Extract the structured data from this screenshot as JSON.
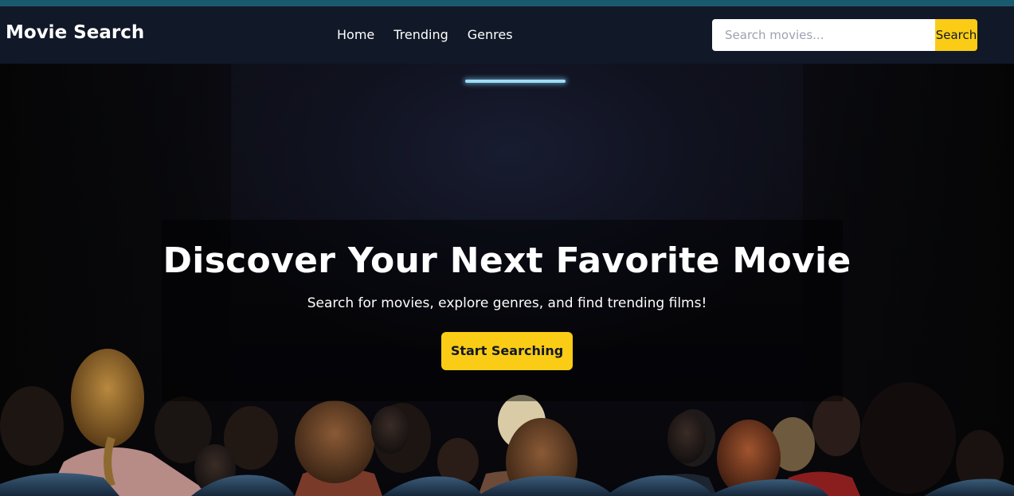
{
  "navbar": {
    "brand": "Movie Search",
    "links": [
      {
        "label": "Home"
      },
      {
        "label": "Trending"
      },
      {
        "label": "Genres"
      }
    ],
    "search": {
      "placeholder": "Search movies...",
      "value": "",
      "button_label": "Search"
    }
  },
  "hero": {
    "title": "Discover Your Next Favorite Movie",
    "subtitle": "Search for movies, explore genres, and find trending films!",
    "cta_label": "Start Searching"
  },
  "colors": {
    "accent": "#facc15",
    "navbar_bg": "#111827",
    "top_strip": "#1b5a6e"
  }
}
